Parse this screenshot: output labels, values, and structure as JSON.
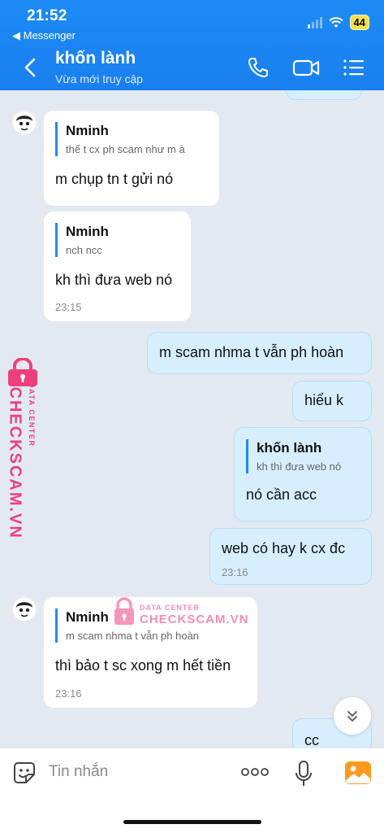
{
  "status_bar": {
    "time": "21:52",
    "back_app": "◀ Messenger",
    "battery": "44"
  },
  "header": {
    "title": "khốn lành",
    "subtitle": "Vừa mới truy cập"
  },
  "messages": [
    {
      "quote_name": "Nminh",
      "quote_text": "thế t cx ph scam như m à",
      "text": "m chụp tn t gửi nó"
    },
    {
      "quote_name": "Nminh",
      "quote_text": "nch ncc",
      "text": "kh thì đưa web nó",
      "time": "23:15"
    },
    {
      "text": "m scam nhma t vẫn ph hoàn"
    },
    {
      "text": "hiểu k"
    },
    {
      "quote_name": "khốn lành",
      "quote_text": "kh thì đưa web nó",
      "text": "nó cần acc"
    },
    {
      "text": "web có hay k cx đc",
      "time": "23:16"
    },
    {
      "quote_name": "Nminh",
      "quote_text": "m scam nhma t vẫn ph hoàn",
      "text": "thì bảo t sc xong m hết tiền",
      "time": "23:16"
    },
    {
      "text": "cc"
    }
  ],
  "watermark": {
    "brand": "CHECKSCAM.VN",
    "tag": "DATA CENTER"
  },
  "input": {
    "placeholder": "Tin nhắn"
  },
  "colors": {
    "header": "#1a7ff0",
    "out_bubble": "#d6eefe",
    "chat_bg": "#e2e9f1",
    "watermark": "#ee3f7d"
  },
  "icons": [
    "back-icon",
    "phone-icon",
    "video-icon",
    "menu-icon",
    "sticker-icon",
    "more-icon",
    "mic-icon",
    "image-icon",
    "chevron-down-icon"
  ]
}
